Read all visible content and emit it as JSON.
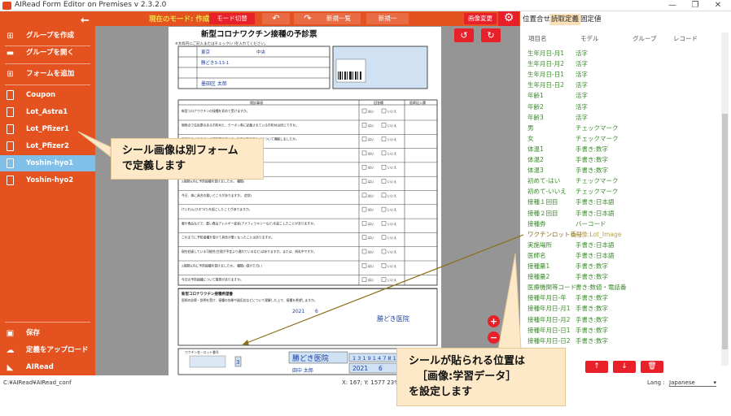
{
  "window": {
    "title": "AIRead Form Editor on Premises v 2.3.2.0",
    "minimize": "—",
    "maximize": "❐",
    "close": "✕"
  },
  "sidebar": {
    "back": "←",
    "actions": [
      {
        "label": "グループを作成",
        "icon": "⊞"
      },
      {
        "label": "グループを開く",
        "icon": "▬"
      },
      {
        "label": "フォームを追加",
        "icon": "⊞"
      }
    ],
    "forms": [
      "Coupon",
      "Lot_Astra1",
      "Lot_Pfizer1",
      "Lot_Pfizer2",
      "Yoshin-hyo1",
      "Yoshin-hyo2"
    ],
    "active_form": "Yoshin-hyo1",
    "footer": [
      {
        "label": "保存",
        "icon": "▣"
      },
      {
        "label": "定義をアップロード",
        "icon": "☁"
      }
    ],
    "brand": "AIRead",
    "color": "#e4521f",
    "active_color": "#7fbfe8"
  },
  "toolbar": {
    "mode_label": "現在のモード: 作成",
    "mode_switch": "モード切替",
    "undo": "↶",
    "redo": "↷",
    "btn1": "新規一覧",
    "btn2": "新規一",
    "image_change": "画像変更"
  },
  "document": {
    "title": "新型コロナワクチン接種の予診票",
    "note": "※太枠内にご記入またはチェック(✓)を入れてください。",
    "address1": "東京",
    "address2": "中央",
    "address3": "勝どき3-13-1",
    "name": "墨田区 太郎",
    "header_left": "問診事項",
    "header_mid": "回答欄",
    "header_right": "医師記入欄",
    "q1": "新型コロナワクチンの接種を初めて受けますか。",
    "q1b": "(接種を受けたことがある場合  1回目:  月  日   2回目:  月  日)",
    "q2": "現時点で住民票のある市町村と、クーポン券に記載されている市町村は同じですか。",
    "q3": "新型コロナワクチンの説明書を読んで、効果や副反応などについて理解しましたか。",
    "q4": "接種を受けますか。",
    "q5": "高齢者施設等の従事者",
    "q6": "2週間以内に予防接種を受けましたか。  種類(",
    "q7": "今日、体に具合の悪いところがありますか。  症状(",
    "q8": "けいれん(ひきつけ)を起こしたことがありますか。",
    "q9": "薬や食品などで、重い食品アレルギー症状(アナフィラキシーなど)を起こしたことがありますか。",
    "q10": "これまでに予防接種を受けて具合が悪くなったことはありますか。",
    "q11": "現在妊娠している可能性(生理が予定より遅れているなど)はありますか。または、授乳中ですか。",
    "q12": "2週間以内に予防接種を受けましたか。  種類(   )受けた日(   )",
    "q13": "今日の予防接種について質問がありますか。",
    "yes": "はい",
    "no": "いいえ",
    "section2": "新型コロナワクチン接種希望書",
    "consent": "医師の診察・説明を受け、接種の効果や副反応などについて理解した上で、接種を希望しますか。",
    "vaccine_label": "ワクチン名・ロット番号",
    "date_year": "2021",
    "date_month": "6",
    "date_day": "30",
    "clinic_name": "勝どき医院",
    "doctor_name": "田中 太郎",
    "clinic_code": "1 3 1 9 1 4 7 8 1 9",
    "dose": "3"
  },
  "panel": {
    "tabs": [
      "位置合せ",
      "読取定義",
      "固定値"
    ],
    "active_tab": "読取定義",
    "columns": [
      "項目名",
      "モデル",
      "グループ",
      "レコード"
    ],
    "rows": [
      {
        "name": "生年月日-月1",
        "model": "活字"
      },
      {
        "name": "生年月日-月2",
        "model": "活字"
      },
      {
        "name": "生年月日-日1",
        "model": "活字"
      },
      {
        "name": "生年月日-日2",
        "model": "活字"
      },
      {
        "name": "年齢1",
        "model": "活字"
      },
      {
        "name": "年齢2",
        "model": "活字"
      },
      {
        "name": "年齢3",
        "model": "活字"
      },
      {
        "name": "男",
        "model": "チェックマーク"
      },
      {
        "name": "女",
        "model": "チェックマーク"
      },
      {
        "name": "体温1",
        "model": "手書き:数字"
      },
      {
        "name": "体温2",
        "model": "手書き:数字"
      },
      {
        "name": "体温3",
        "model": "手書き:数字"
      },
      {
        "name": "初めて-はい",
        "model": "チェックマーク"
      },
      {
        "name": "初めて-いいえ",
        "model": "チェックマーク"
      },
      {
        "name": "接種１回目",
        "model": "手書き:日本語"
      },
      {
        "name": "接種２回目",
        "model": "手書き:日本語"
      },
      {
        "name": "接種券",
        "model": "バーコード"
      },
      {
        "name": "ワクチンロット番号",
        "model": "画像:Lot_Image"
      },
      {
        "name": "実施場所",
        "model": "手書き:日本語"
      },
      {
        "name": "医師名",
        "model": "手書き:日本語"
      },
      {
        "name": "接種量1",
        "model": "手書き:数字"
      },
      {
        "name": "接種量2",
        "model": "手書き:数字"
      },
      {
        "name": "医療機関等コード",
        "model": "書き:数値・電話番"
      },
      {
        "name": "接種年月日-年",
        "model": "手書き:数字"
      },
      {
        "name": "接種年月日-月1",
        "model": "手書き:数字"
      },
      {
        "name": "接種年月日-月2",
        "model": "手書き:数字"
      },
      {
        "name": "接種年月日-日1",
        "model": "手書き:数字"
      },
      {
        "name": "接種年月日-日2",
        "model": "手書き:数字"
      }
    ],
    "highlight_index": 17,
    "up": "↑",
    "down": "↓",
    "delete": "🗑"
  },
  "status": {
    "path": "C:¥AIRead¥AIRead_conf",
    "coords": "X: 167; Y: 1577  23%",
    "lang_label": "Lang :",
    "lang_value": "Japanese"
  },
  "callouts": {
    "c1": [
      "シール画像は別フォーム",
      "で定義します"
    ],
    "c2": [
      "シールが貼られる位置は",
      "［画像:学習データ］",
      "を設定します"
    ]
  },
  "zoom": {
    "in": "+",
    "out": "−"
  }
}
